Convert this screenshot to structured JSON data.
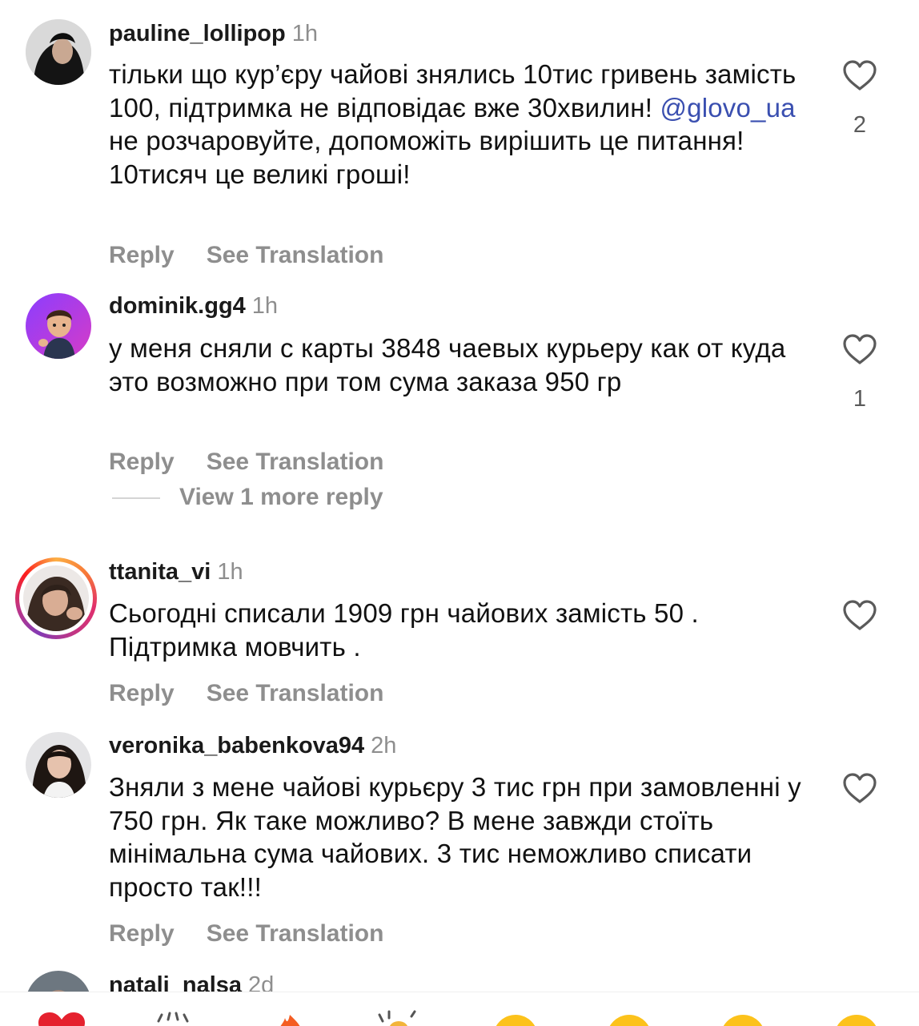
{
  "comments": [
    {
      "username": "pauline_lollipop",
      "time": "1h",
      "text_before": "тільки що кур’єру чайові знялись 10тис гривень замість 100, підтримка не відповідає вже 30хвилин! ",
      "mention": "@glovo_ua",
      "text_after": " не розчаровуйте, допоможіть вирішить це питання! 10тисяч це великі гроші!",
      "likes": "2",
      "reply_label": "Reply",
      "translate_label": "See Translation"
    },
    {
      "username": "dominik.gg4",
      "time": "1h",
      "text": "у меня сняли с карты 3848 чаевых курьеру как от куда это возможно при том сума заказа 950 гр",
      "likes": "1",
      "reply_label": "Reply",
      "translate_label": "See Translation",
      "more_replies_label": "View 1 more reply"
    },
    {
      "username": "ttanita_vi",
      "time": "1h",
      "text": "Сьогодні списали 1909 грн чайових замість 50 . Підтримка мовчить .",
      "reply_label": "Reply",
      "translate_label": "See Translation"
    },
    {
      "username": "veronika_babenkova94",
      "time": "2h",
      "text": "Зняли з мене чайові курьєру 3 тис грн при замовленні у 750 грн. Як таке можливо? В мене завжди стоїть мінімальна сума чайових. 3 тис неможливо списати просто так!!!",
      "reply_label": "Reply",
      "translate_label": "See Translation"
    },
    {
      "username": "natali_nalsa",
      "time": "2d"
    }
  ],
  "icons": {
    "like": "heart-outline-icon",
    "emoji_bar": [
      "red-heart-emoji",
      "raising-hands-emoji",
      "fire-emoji",
      "clapping-hands-emoji",
      "crying-face-emoji",
      "heart-eyes-emoji",
      "open-mouth-emoji",
      "laughing-emoji"
    ]
  },
  "colors": {
    "secondary_text": "#8e8e8e",
    "mention": "#3a4fb0",
    "story_ring": "#e1306c"
  }
}
